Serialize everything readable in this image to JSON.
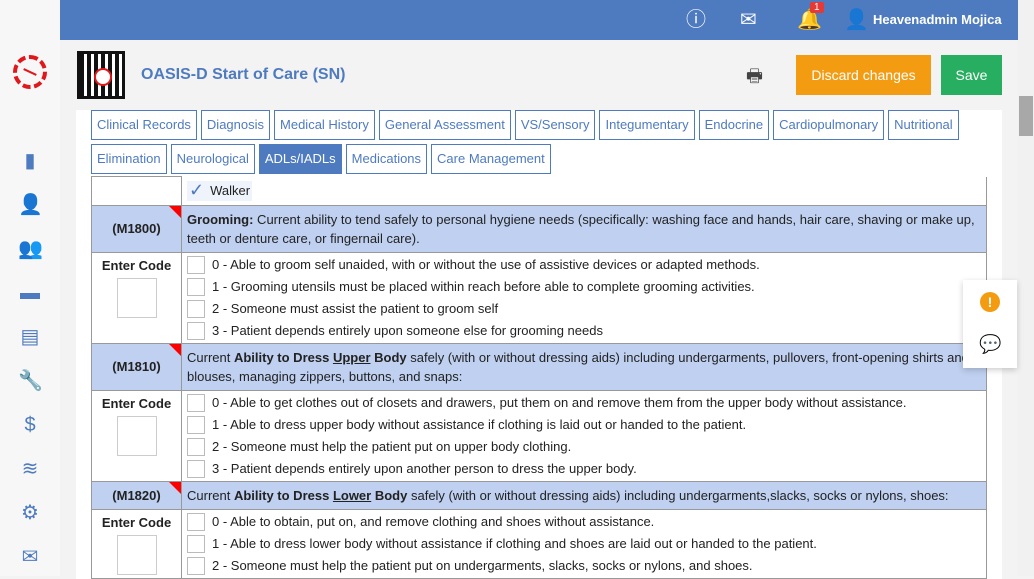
{
  "topbar": {
    "user_name": "Heavenadmin Mojica",
    "notification_count": "1",
    "icons": [
      "help-icon",
      "mail-icon",
      "bell-icon",
      "user-icon"
    ]
  },
  "sidebar": {
    "items": [
      "chart-icon",
      "user-add-icon",
      "users-icon",
      "folder-add-icon",
      "document-icon",
      "wrench-icon",
      "dollar-icon",
      "layers-icon",
      "gear-icon",
      "mail-icon"
    ]
  },
  "header": {
    "title": "OASIS-D Start of Care (SN)",
    "discard_label": "Discard changes",
    "save_label": "Save"
  },
  "tabs": {
    "row1": [
      "Clinical Records",
      "Diagnosis",
      "Medical History",
      "General Assessment",
      "VS/Sensory",
      "Integumentary",
      "Endocrine",
      "Cardiopulmonary",
      "Nutritional"
    ],
    "row2": [
      "Elimination",
      "Neurological",
      "ADLs/IADLs",
      "Medications",
      "Care Management"
    ],
    "active": "ADLs/IADLs"
  },
  "form": {
    "walker_label": "Walker",
    "enter_code": "Enter Code",
    "m1800": {
      "code": "(M1800)",
      "bold": "Grooming:",
      "text": " Current ability to tend safely to personal hygiene needs (specifically: washing face and hands, hair care, shaving or make up, teeth or denture care, or fingernail care).",
      "options": [
        "0 - Able to groom self unaided, with or without the use of assistive devices or adapted methods.",
        "1 - Grooming utensils must be placed within reach before able to complete grooming activities.",
        "2 - Someone must assist the patient to groom self",
        "3 - Patient depends entirely upon someone else for grooming needs"
      ]
    },
    "m1810": {
      "code": "(M1810)",
      "pre": "Current ",
      "bold1": "Ability to Dress ",
      "under": "Upper",
      "bold2": " Body",
      "text": " safely (with or without dressing aids) including undergarments, pullovers, front-opening shirts and blouses, managing zippers, buttons, and snaps:",
      "options": [
        "0 - Able to get clothes out of closets and drawers, put them on and remove them from the upper body without assistance.",
        "1 - Able to dress upper body without assistance if clothing is laid out or handed to the patient.",
        "2 - Someone must help the patient put on upper body clothing.",
        "3 - Patient depends entirely upon another person to dress the upper body."
      ]
    },
    "m1820": {
      "code": "(M1820)",
      "pre": "Current ",
      "bold1": "Ability to Dress ",
      "under": "Lower",
      "bold2": " Body",
      "text": " safely (with or without dressing aids) including undergarments,slacks, socks or nylons, shoes:",
      "options": [
        "0 - Able to obtain, put on, and remove clothing and shoes without assistance.",
        "1 - Able to dress lower body without assistance if clothing and shoes are laid out or handed to the patient.",
        "2 - Someone must help the patient put on undergarments, slacks, socks or nylons, and shoes."
      ]
    }
  }
}
